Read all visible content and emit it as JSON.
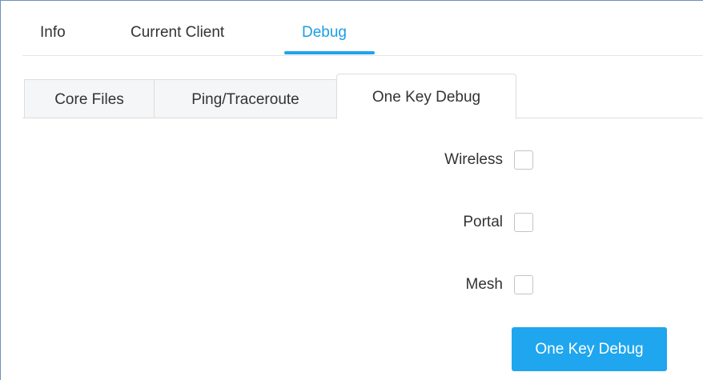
{
  "top_tabs": [
    {
      "label": "Info",
      "active": false
    },
    {
      "label": "Current Client",
      "active": false
    },
    {
      "label": "Debug",
      "active": true
    }
  ],
  "sub_tabs": [
    {
      "label": "Core Files",
      "active": false
    },
    {
      "label": "Ping/Traceroute",
      "active": false
    },
    {
      "label": "One Key Debug",
      "active": true
    }
  ],
  "options": [
    {
      "label": "Wireless",
      "checked": false
    },
    {
      "label": "Portal",
      "checked": false
    },
    {
      "label": "Mesh",
      "checked": false
    }
  ],
  "action": {
    "button_label": "One Key Debug"
  },
  "colors": {
    "accent": "#1fa6ef",
    "active_tab_text": "#1a9ee8",
    "border": "#dddddd",
    "inactive_tab_bg": "#f5f6f7"
  }
}
